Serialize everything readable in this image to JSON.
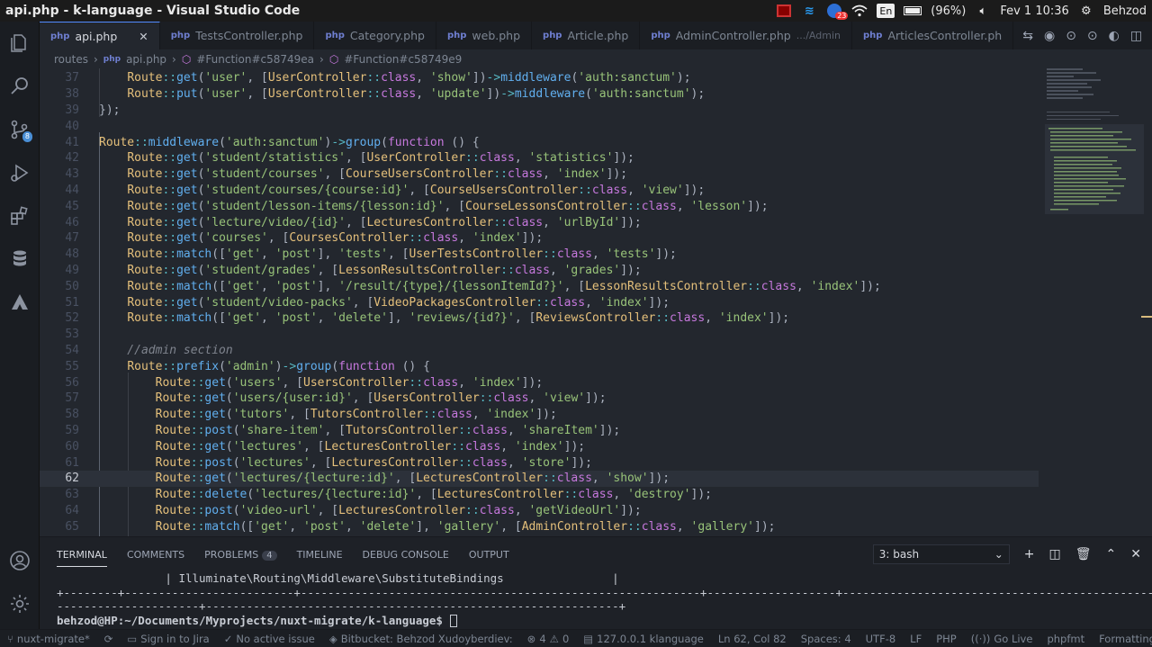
{
  "window": {
    "title": "api.php - k-language - Visual Studio Code"
  },
  "system": {
    "notification_count": "23",
    "keyboard": "En",
    "battery": "(96%)",
    "datetime": "Fev  1 10:36",
    "user": "Behzod"
  },
  "tabs": [
    {
      "label": "api.php",
      "active": true
    },
    {
      "label": "TestsController.php"
    },
    {
      "label": "Category.php"
    },
    {
      "label": "web.php"
    },
    {
      "label": "Article.php"
    },
    {
      "label": "AdminController.php",
      "desc": ".../Admin"
    },
    {
      "label": "ArticlesController.ph"
    }
  ],
  "breadcrumb": {
    "folder": "routes",
    "file": "api.php",
    "sym1": "#Function#c58749ea",
    "sym2": "#Function#c58749e9"
  },
  "activity": {
    "scm_badge": "8"
  },
  "editor": {
    "current_line": "62",
    "lines": [
      {
        "n": "37",
        "t": "        Route::get('user', [UserController::class, 'show'])->middleware('auth:sanctum');"
      },
      {
        "n": "38",
        "t": "        Route::put('user', [UserController::class, 'update'])->middleware('auth:sanctum');"
      },
      {
        "n": "39",
        "t": "    });"
      },
      {
        "n": "40",
        "t": ""
      },
      {
        "n": "41",
        "t": "    Route::middleware('auth:sanctum')->group(function () {"
      },
      {
        "n": "42",
        "t": "        Route::get('student/statistics', [UserController::class, 'statistics']);"
      },
      {
        "n": "43",
        "t": "        Route::get('student/courses', [CourseUsersController::class, 'index']);"
      },
      {
        "n": "44",
        "t": "        Route::get('student/courses/{course:id}', [CourseUsersController::class, 'view']);"
      },
      {
        "n": "45",
        "t": "        Route::get('student/lesson-items/{lesson:id}', [CourseLessonsController::class, 'lesson']);"
      },
      {
        "n": "46",
        "t": "        Route::get('lecture/video/{id}', [LecturesController::class, 'urlById']);"
      },
      {
        "n": "47",
        "t": "        Route::get('courses', [CoursesController::class, 'index']);"
      },
      {
        "n": "48",
        "t": "        Route::match(['get', 'post'], 'tests', [UserTestsController::class, 'tests']);"
      },
      {
        "n": "49",
        "t": "        Route::get('student/grades', [LessonResultsController::class, 'grades']);"
      },
      {
        "n": "50",
        "t": "        Route::match(['get', 'post'], '/result/{type}/{lessonItemId?}', [LessonResultsController::class, 'index']);"
      },
      {
        "n": "51",
        "t": "        Route::get('student/video-packs', [VideoPackagesController::class, 'index']);"
      },
      {
        "n": "52",
        "t": "        Route::match(['get', 'post', 'delete'], 'reviews/{id?}', [ReviewsController::class, 'index']);"
      },
      {
        "n": "53",
        "t": ""
      },
      {
        "n": "54",
        "t": "        //admin section"
      },
      {
        "n": "55",
        "t": "        Route::prefix('admin')->group(function () {"
      },
      {
        "n": "56",
        "t": "            Route::get('users', [UsersController::class, 'index']);"
      },
      {
        "n": "57",
        "t": "            Route::get('users/{user:id}', [UsersController::class, 'view']);"
      },
      {
        "n": "58",
        "t": "            Route::get('tutors', [TutorsController::class, 'index']);"
      },
      {
        "n": "59",
        "t": "            Route::post('share-item', [TutorsController::class, 'shareItem']);"
      },
      {
        "n": "60",
        "t": "            Route::get('lectures', [LecturesController::class, 'index']);"
      },
      {
        "n": "61",
        "t": "            Route::post('lectures', [LecturesController::class, 'store']);"
      },
      {
        "n": "62",
        "t": "            Route::get('lectures/{lecture:id}', [LecturesController::class, 'show']);"
      },
      {
        "n": "63",
        "t": "            Route::delete('lectures/{lecture:id}', [LecturesController::class, 'destroy']);"
      },
      {
        "n": "64",
        "t": "            Route::post('video-url', [LecturesController::class, 'getVideoUrl']);"
      },
      {
        "n": "65",
        "t": "            Route::match(['get', 'post', 'delete'], 'gallery', [AdminController::class, 'gallery']);"
      }
    ]
  },
  "panel": {
    "tabs": [
      {
        "label": "TERMINAL",
        "active": true
      },
      {
        "label": "COMMENTS"
      },
      {
        "label": "PROBLEMS",
        "count": "4"
      },
      {
        "label": "TIMELINE"
      },
      {
        "label": "DEBUG CONSOLE"
      },
      {
        "label": "OUTPUT"
      }
    ],
    "shell": "3: bash",
    "terminal": [
      "                | Illuminate\\Routing\\Middleware\\SubstituteBindings                |",
      "+--------+-------------------------+-----------------------------------------------------------+-------------------+------------------------------------------------------",
      "---------------------+-------------------------------------------------------------+"
    ],
    "prompt": "behzod@HP:~/Documents/Myprojects/nuxt-migrate/k-language$"
  },
  "status": {
    "left": [
      "nuxt-migrate*",
      "",
      "Sign in to Jira",
      "No active issue",
      "Bitbucket: Behzod Xudoyberdiev:",
      "4",
      "0",
      "127.0.0.1  klanguage"
    ],
    "right": [
      "Ln 62, Col 82",
      "Spaces: 4",
      "UTF-8",
      "LF",
      "PHP",
      "Go Live",
      "phpfmt",
      "Formatting: "
    ]
  }
}
